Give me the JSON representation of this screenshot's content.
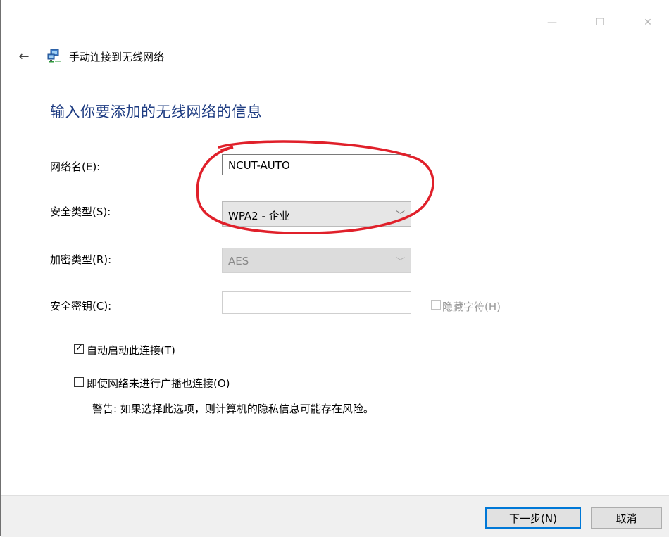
{
  "window": {
    "title": "手动连接到无线网络",
    "controls": {
      "minimize": "—",
      "maximize": "☐",
      "close": "✕"
    },
    "back_icon": "back-arrow-icon",
    "app_icon": "network-icon"
  },
  "heading": "输入你要添加的无线网络的信息",
  "form": {
    "network_name": {
      "label": "网络名(E):",
      "value": "NCUT-AUTO"
    },
    "security_type": {
      "label": "安全类型(S):",
      "value": "WPA2 - 企业"
    },
    "encryption_type": {
      "label": "加密类型(R):",
      "value": "AES",
      "disabled": true
    },
    "security_key": {
      "label": "安全密钥(C):",
      "value": "",
      "hide_chars_label": "隐藏字符(H)",
      "disabled": true
    }
  },
  "options": {
    "auto_connect": {
      "label": "自动启动此连接(T)",
      "checked": true
    },
    "connect_hidden": {
      "label": "即使网络未进行广播也连接(O)",
      "checked": false
    },
    "warning": "警告: 如果选择此选项，则计算机的隐私信息可能存在风险。"
  },
  "footer": {
    "next_button": "下一步(N)",
    "cancel_button": "取消"
  },
  "colors": {
    "heading": "#1e3c82",
    "primary_border": "#0078d7",
    "annotation": "#e0202a"
  }
}
